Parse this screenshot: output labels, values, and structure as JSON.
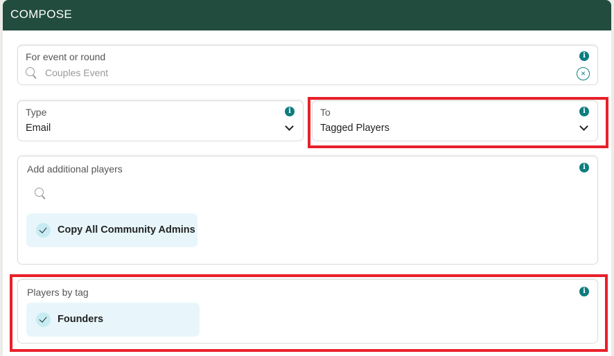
{
  "header": {
    "title": "COMPOSE"
  },
  "event": {
    "label": "For event or round",
    "placeholder": "Couples Event",
    "info": "i",
    "clear": "×"
  },
  "type": {
    "label": "Type",
    "value": "Email",
    "info": "i"
  },
  "to": {
    "label": "To",
    "value": "Tagged Players",
    "info": "i"
  },
  "additional": {
    "label": "Add additional players",
    "info": "i",
    "chips": [
      {
        "label": "Copy All Community Admins"
      }
    ]
  },
  "tags": {
    "label": "Players by tag",
    "info": "i",
    "chips": [
      {
        "label": "Founders"
      }
    ]
  },
  "colors": {
    "header": "#224c3e",
    "accent": "#0e7c80",
    "highlight": "#e8202a"
  }
}
